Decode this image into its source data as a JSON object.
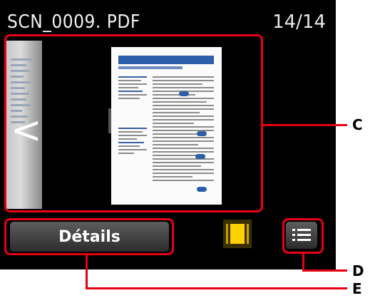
{
  "header": {
    "title": "SCN_0009. PDF",
    "counter": "14/14"
  },
  "preview": {
    "prev_arrow": "<"
  },
  "footer": {
    "details_label": "Détails"
  },
  "callouts": {
    "c": "C",
    "d": "D",
    "e": "E"
  },
  "colors": {
    "highlight": "#e60012",
    "selected_layout": "#ffd000"
  },
  "icons": {
    "prev": "chevron-left-icon",
    "layout": "single-page-layout-icon",
    "list": "list-icon"
  }
}
